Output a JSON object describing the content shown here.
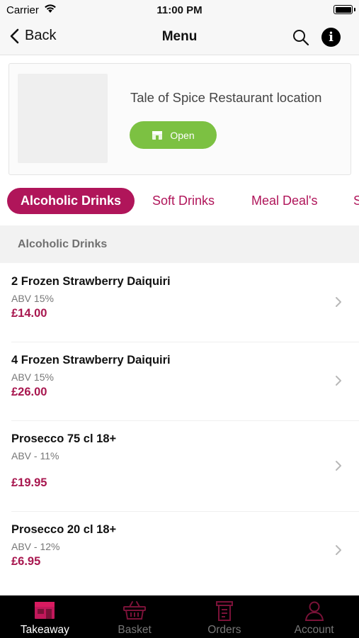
{
  "status_bar": {
    "carrier": "Carrier",
    "time": "11:00 PM"
  },
  "nav": {
    "back_label": "Back",
    "title": "Menu"
  },
  "restaurant": {
    "name": "Tale of Spice Restaurant  location",
    "open_label": "Open"
  },
  "categories": [
    {
      "label": "Alcoholic Drinks",
      "active": true
    },
    {
      "label": "Soft Drinks",
      "active": false
    },
    {
      "label": "Meal Deal's",
      "active": false
    },
    {
      "label": "S",
      "active": false
    }
  ],
  "section": {
    "title": "Alcoholic Drinks"
  },
  "items": [
    {
      "name": "2 Frozen Strawberry Daiquiri",
      "description": "ABV 15%",
      "price": "£14.00"
    },
    {
      "name": "4 Frozen Strawberry Daiquiri",
      "description": "ABV 15%",
      "price": "£26.00"
    },
    {
      "name": "Prosecco 75 cl 18+",
      "description": "ABV - 11%",
      "price": "£19.95"
    },
    {
      "name": "Prosecco 20 cl 18+",
      "description": "ABV - 12%",
      "price": "£6.95"
    }
  ],
  "tab_bar": [
    {
      "label": "Takeaway",
      "icon": "store-icon",
      "active": true
    },
    {
      "label": "Basket",
      "icon": "basket-icon",
      "active": false
    },
    {
      "label": "Orders",
      "icon": "receipt-icon",
      "active": false
    },
    {
      "label": "Account",
      "icon": "person-icon",
      "active": false
    }
  ],
  "colors": {
    "accent": "#b0155a",
    "price": "#a8174f",
    "open_green": "#7cc142",
    "tab_bar_bg": "#000000",
    "tab_icon_active": "#c2185b",
    "tab_icon_inactive": "#7a1238"
  }
}
